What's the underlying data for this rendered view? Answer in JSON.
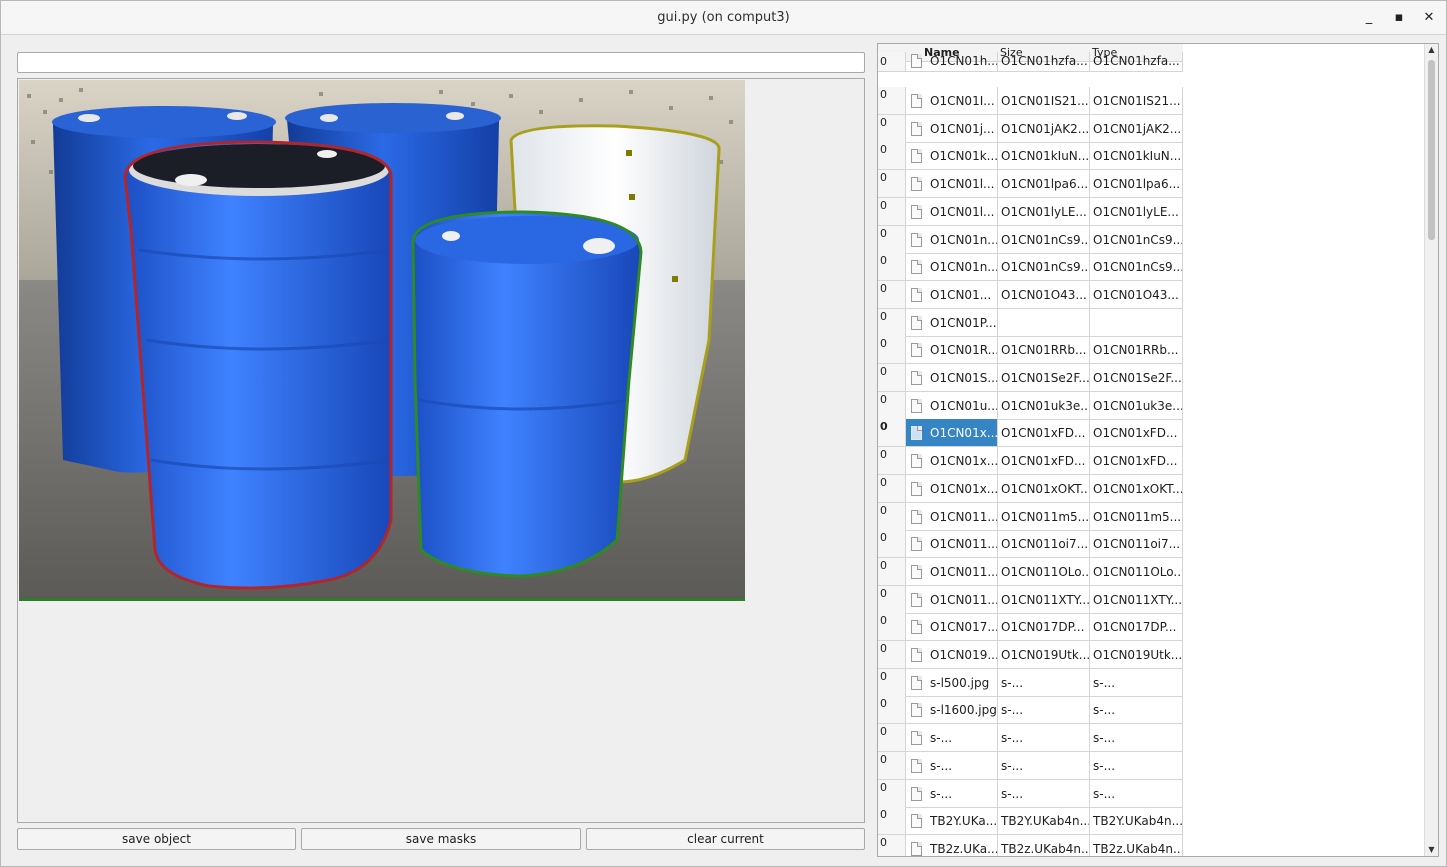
{
  "window": {
    "title": "gui.py (on comput3)"
  },
  "path_input": {
    "value": ""
  },
  "buttons": {
    "save_object": "save object",
    "save_masks": "save masks",
    "clear_current": "clear current"
  },
  "table": {
    "headers": {
      "index": "",
      "name": "Name",
      "size": "Size",
      "type": "Type"
    },
    "rows": [
      {
        "idx": "0",
        "name": "O1CN01h...",
        "size": "O1CN01hzfa...",
        "type": "O1CN01hzfa..."
      },
      {
        "idx": "0",
        "name": "O1CN01I...",
        "size": "O1CN01IS21...",
        "type": "O1CN01IS21..."
      },
      {
        "idx": "0",
        "name": "O1CN01j...",
        "size": "O1CN01jAK2...",
        "type": "O1CN01jAK2..."
      },
      {
        "idx": "0",
        "name": "O1CN01k...",
        "size": "O1CN01kIuN...",
        "type": "O1CN01kIuN..."
      },
      {
        "idx": "0",
        "name": "O1CN01l...",
        "size": "O1CN01lpa6...",
        "type": "O1CN01lpa6..."
      },
      {
        "idx": "0",
        "name": "O1CN01l...",
        "size": "O1CN01lyLE...",
        "type": "O1CN01lyLE..."
      },
      {
        "idx": "0",
        "name": "O1CN01n...",
        "size": "O1CN01nCs9...",
        "type": "O1CN01nCs9..."
      },
      {
        "idx": "0",
        "name": "O1CN01n...",
        "size": "O1CN01nCs9...",
        "type": "O1CN01nCs9..."
      },
      {
        "idx": "0",
        "name": "O1CN01...",
        "size": "O1CN01O43...",
        "type": "O1CN01O43..."
      },
      {
        "idx": "0",
        "name": "O1CN01P...",
        "size": "",
        "type": ""
      },
      {
        "idx": "0",
        "name": "O1CN01R...",
        "size": "O1CN01RRb...",
        "type": "O1CN01RRb..."
      },
      {
        "idx": "0",
        "name": "O1CN01S...",
        "size": "O1CN01Se2F...",
        "type": "O1CN01Se2F..."
      },
      {
        "idx": "0",
        "name": "O1CN01u...",
        "size": "O1CN01uk3e...",
        "type": "O1CN01uk3e..."
      },
      {
        "idx": "0",
        "name": "O1CN01x...",
        "size": "O1CN01xFD...",
        "type": "O1CN01xFD...",
        "selected": true
      },
      {
        "idx": "0",
        "name": "O1CN01x...",
        "size": "O1CN01xFD...",
        "type": "O1CN01xFD..."
      },
      {
        "idx": "0",
        "name": "O1CN01x...",
        "size": "O1CN01xOKT...",
        "type": "O1CN01xOKT..."
      },
      {
        "idx": "0",
        "name": "O1CN011...",
        "size": "O1CN011m5...",
        "type": "O1CN011m5..."
      },
      {
        "idx": "0",
        "name": "O1CN011...",
        "size": "O1CN011oi7...",
        "type": "O1CN011oi7..."
      },
      {
        "idx": "0",
        "name": "O1CN011...",
        "size": "O1CN011OLo...",
        "type": "O1CN011OLo..."
      },
      {
        "idx": "0",
        "name": "O1CN011...",
        "size": "O1CN011XTY...",
        "type": "O1CN011XTY..."
      },
      {
        "idx": "0",
        "name": "O1CN017...",
        "size": "O1CN017DP...",
        "type": "O1CN017DP..."
      },
      {
        "idx": "0",
        "name": "O1CN019...",
        "size": "O1CN019Utk...",
        "type": "O1CN019Utk..."
      },
      {
        "idx": "0",
        "name": "s-l500.jpg",
        "size": "s-...",
        "type": "s-..."
      },
      {
        "idx": "0",
        "name": "s-l1600.jpg",
        "size": "s-...",
        "type": "s-..."
      },
      {
        "idx": "0",
        "name": "s-...",
        "size": "s-...",
        "type": "s-..."
      },
      {
        "idx": "0",
        "name": "s-...",
        "size": "s-...",
        "type": "s-..."
      },
      {
        "idx": "0",
        "name": "s-...",
        "size": "s-...",
        "type": "s-..."
      },
      {
        "idx": "0",
        "name": "TB2Y.UKa...",
        "size": "TB2Y.UKab4n...",
        "type": "TB2Y.UKab4n..."
      },
      {
        "idx": "0",
        "name": "TB2z.UKa...",
        "size": "TB2z.UKab4n...",
        "type": "TB2z.UKab4n..."
      }
    ]
  },
  "colors": {
    "mask_red": "#b1262b",
    "mask_green": "#2f8a23",
    "mask_yellow": "#a8a01d",
    "selection": "#3584c4",
    "barrel_blue": "#1f5fd6"
  }
}
